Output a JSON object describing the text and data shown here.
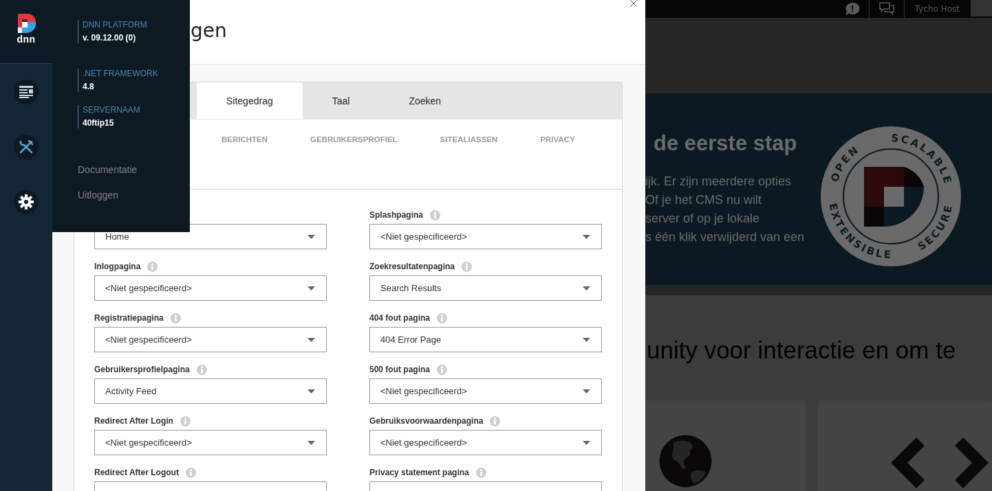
{
  "sidebar": {
    "logo": "dnn"
  },
  "flyout": {
    "info": [
      {
        "label": "DNN PLATFORM",
        "value": "v. 09.12.00 (0)"
      },
      {
        "label": ".NET FRAMEWORK",
        "value": "4.8"
      },
      {
        "label": "SERVERNAAM",
        "value": "40ftip15"
      }
    ],
    "links": [
      "Documentatie",
      "Uitloggen"
    ]
  },
  "dialog": {
    "title": "gen",
    "tabs": [
      {
        "label": "Sitegedrag",
        "selected": true
      },
      {
        "label": "Taal",
        "selected": false
      },
      {
        "label": "Zoeken",
        "selected": false
      }
    ],
    "subtabs": [
      "BERICHTEN",
      "GEBRUIKERSPROFIEL",
      "SITEALIASSEN",
      "PRIVACY"
    ],
    "columns": [
      [
        {
          "value": "Home"
        },
        {
          "label": "Inlogpagina",
          "value": "<Niet gespecificeerd>"
        },
        {
          "label": "Registratiepagina",
          "value": "<Niet gespecificeerd>"
        },
        {
          "label": "Gebruikersprofielpagina",
          "value": "Activity Feed"
        },
        {
          "label": "Redirect After Login",
          "value": "<Niet gespecificeerd>"
        },
        {
          "label": "Redirect After Logout"
        }
      ],
      [
        {
          "label": "Splashpagina",
          "value": "<Niet gespecificeerd>"
        },
        {
          "label": "Zoekresultatenpagina",
          "value": "Search Results"
        },
        {
          "label": "404 fout pagina",
          "value": "404 Error Page"
        },
        {
          "label": "500 fout pagina",
          "value": "<Niet gespecificeerd>"
        },
        {
          "label": "Gebruiksvoorwaardenpagina",
          "value": "<Niet gespecificeerd>"
        },
        {
          "label": "Privacy statement pagina"
        }
      ]
    ]
  },
  "site": {
    "user": "Tycho Host",
    "banner": {
      "heading": "de eerste stap",
      "lines": [
        "ijk. Er zijn meerdere opties",
        "Of je het CMS nu wilt",
        "server of op je lokale",
        "s één klik verwijderd van een"
      ],
      "badge": [
        "OPEN",
        "SCALABLE",
        "EXTENSIBLE",
        "SECURE"
      ]
    },
    "community": {
      "heading": "unity voor interactie en om te"
    }
  }
}
